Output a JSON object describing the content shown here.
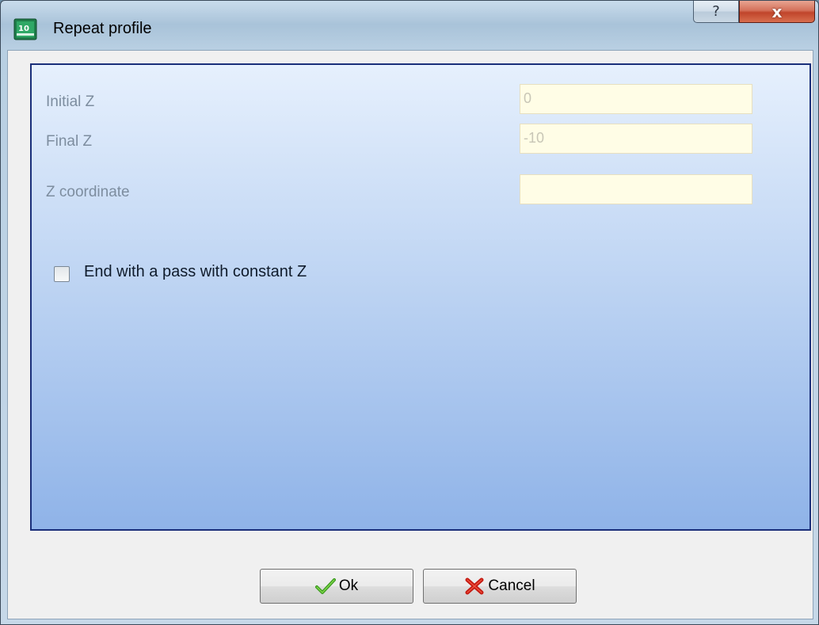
{
  "window": {
    "title": "Repeat profile",
    "help_glyph": "?",
    "close_glyph": "x"
  },
  "fields": {
    "initial_z": {
      "label": "Initial Z",
      "value": "0"
    },
    "final_z": {
      "label": "Final Z",
      "value": "-10"
    },
    "z_coordinate": {
      "label": "Z coordinate",
      "value": ""
    }
  },
  "options": {
    "constant_z_pass": {
      "label": "End with a pass with constant Z",
      "checked": false
    }
  },
  "buttons": {
    "ok": {
      "label": "Ok",
      "icon": "checkmark-icon"
    },
    "cancel": {
      "label": "Cancel",
      "icon": "red-x-icon"
    }
  },
  "colors": {
    "field_background": "#fffde6",
    "panel_border": "#1a2f7a",
    "close_button": "#c0452b"
  }
}
